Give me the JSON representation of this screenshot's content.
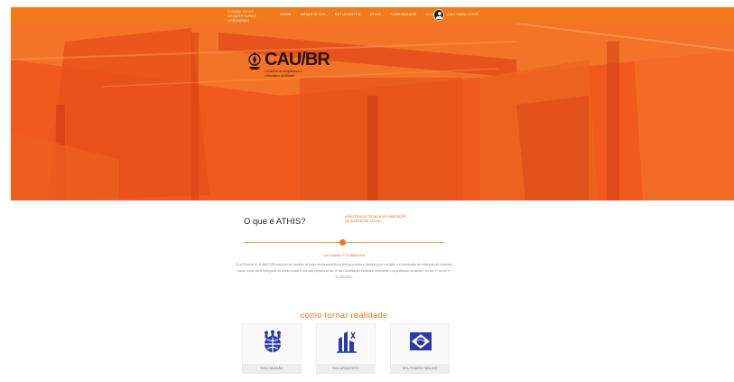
{
  "header": {
    "brand_lines": "CONSELHO DE ARQUITETURA E URBANISMO",
    "nav": [
      "HOME",
      "ARQUITETOS",
      "ESTUDANTES",
      "ATHIS",
      "COMUNIDADE",
      "O CAU",
      "CAU PARA VOCÊ"
    ]
  },
  "hero": {
    "logo_title": "CAU/BR",
    "logo_subtitle": "Conselho de Arquitetura e Urbanismo do Brasil"
  },
  "about": {
    "title": "O que é ATHIS?",
    "side_note": "ASSISTÊNCIA TÉCNICA EM HABITAÇÃO DE INTERESSE SOCIAL",
    "law": "Lei Federal nº 11.888/2008",
    "body": "A Lei Federal nº 11.888/2008 assegura às famílias de baixa renda assistência técnica pública e gratuita para o projeto e a construção de habitação de interesse social, como parte integrante do direito social à moradia previsto no art. 6º da Constituição Federal e consoante o especificado na alínea r do art. 4º da Lei nº 10.257/2001."
  },
  "section_title": "como tornar realidade",
  "cards": [
    {
      "label": "SOU CIDADÃO",
      "icon": "people-globe-icon"
    },
    {
      "label": "SOU ARQUITETO",
      "icon": "architect-building-icon"
    },
    {
      "label": "SOU PODER PÚBLICO",
      "icon": "public-power-flag-icon"
    }
  ],
  "colors": {
    "accent": "#f07a1c",
    "hero_base": "#f0521a",
    "icon_blue": "#2b3aa8"
  }
}
